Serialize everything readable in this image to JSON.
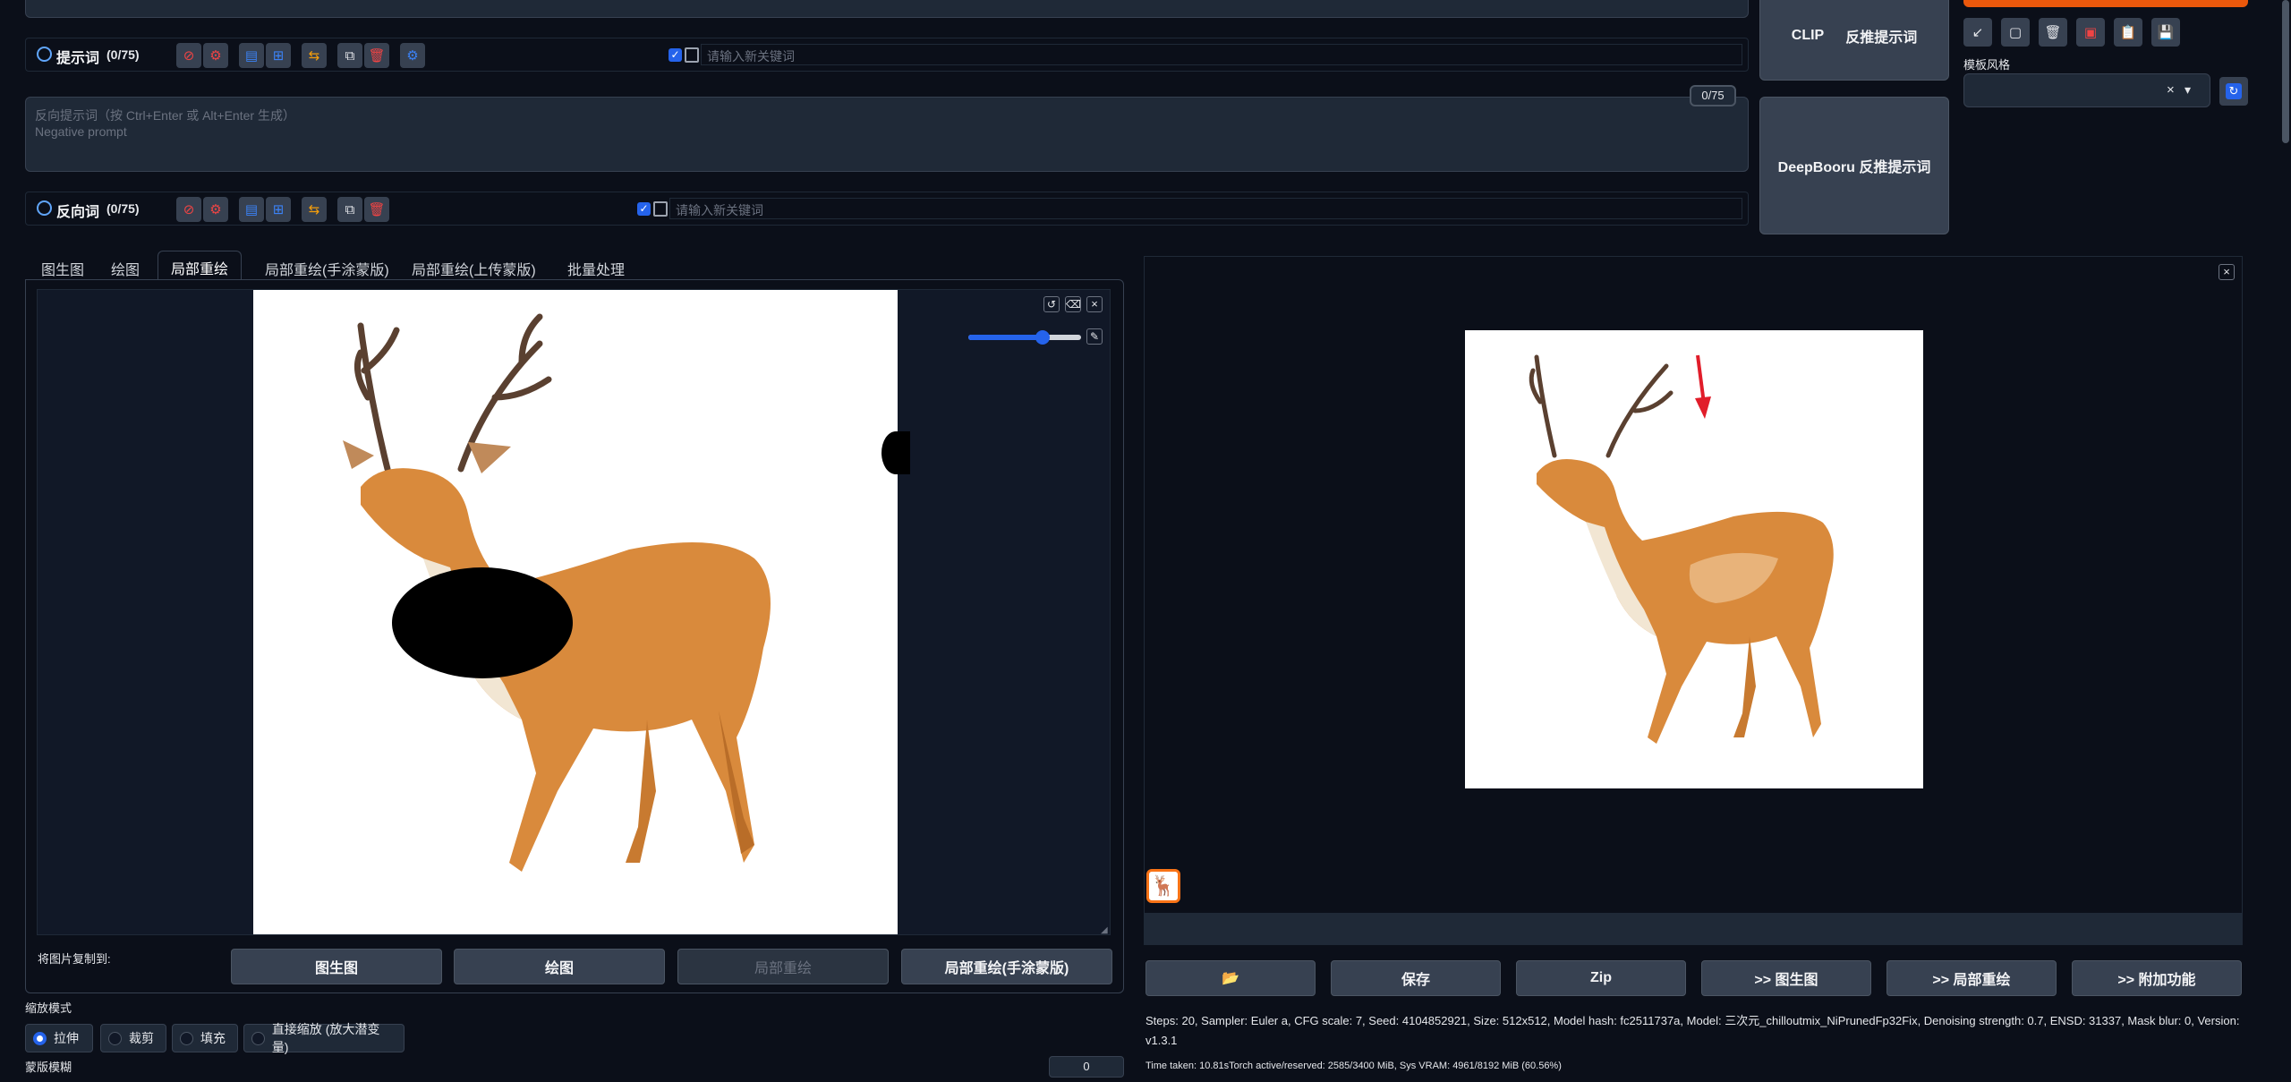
{
  "prompt_row": {
    "label": "提示词",
    "count": "(0/75)",
    "keyword_placeholder": "请输入新关键词"
  },
  "negative": {
    "placeholder_line1": "反向提示词（按 Ctrl+Enter 或 Alt+Enter 生成）",
    "placeholder_line2": "Negative prompt",
    "token_counter": "0/75",
    "row_label": "反向词",
    "row_count": "(0/75)",
    "keyword_placeholder": "请输入新关键词"
  },
  "interrogate": {
    "clip_label": "CLIP",
    "clip_sub": "反推提示词",
    "deepbooru_label": "DeepBooru 反推提示词"
  },
  "styles": {
    "label": "模板风格",
    "clear_icon": "×",
    "dropdown_icon": "▾"
  },
  "tabs": [
    "图生图",
    "绘图",
    "局部重绘",
    "局部重绘(手涂蒙版)",
    "局部重绘(上传蒙版)",
    "批量处理"
  ],
  "active_tab_index": 2,
  "brush_slider_value": 0.65,
  "copy_to": {
    "label": "将图片复制到:",
    "buttons": [
      "图生图",
      "绘图",
      "局部重绘",
      "局部重绘(手涂蒙版)"
    ]
  },
  "resize_mode": {
    "label": "缩放模式",
    "options": [
      "拉伸",
      "裁剪",
      "填充",
      "直接缩放 (放大潜变量)"
    ],
    "selected_index": 0
  },
  "mask_blur": {
    "label": "蒙版模糊",
    "value": "0"
  },
  "output_actions": {
    "folder_icon": "📂",
    "buttons": [
      "保存",
      "Zip",
      ">> 图生图",
      ">> 局部重绘",
      ">> 附加功能"
    ]
  },
  "generation_info": "Steps: 20, Sampler: Euler a, CFG scale: 7, Seed: 4104852921, Size: 512x512, Model hash: fc2511737a, Model: 三次元_chilloutmix_NiPrunedFp32Fix, Denoising strength: 0.7, ENSD: 31337, Mask blur: 0, Version: v1.3.1",
  "time_info": "Time taken: 10.81sTorch active/reserved: 2585/3400 MiB, Sys VRAM: 4961/8192 MiB (60.56%)",
  "colors": {
    "accent_blue": "#2563eb",
    "generate_orange": "#ea580c",
    "arrow_red": "#e11d2a"
  }
}
